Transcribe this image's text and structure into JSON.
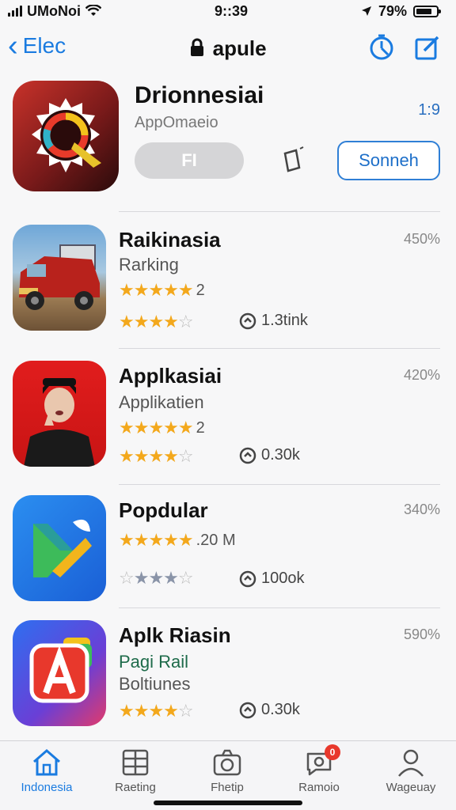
{
  "status": {
    "carrier": "UMoNoi",
    "time": "9::39",
    "battery": "79%",
    "battery_level": 0.79
  },
  "nav": {
    "back_label": "Elec",
    "title": "apule",
    "title_icon": "lock-icon",
    "timer_icon": "timer-icon",
    "compose_icon": "compose-icon"
  },
  "featured": {
    "title": "Drionnesiai",
    "subtitle": "AppOmaeio",
    "get_label": "FI",
    "side_value": "1:9",
    "search_label": "Sonneh"
  },
  "apps": [
    {
      "title": "Raikinasia",
      "percent": "450%",
      "lines": [
        "Rarking"
      ],
      "rating_text": "2",
      "rating_stars": 4,
      "downloads": "1.3tink"
    },
    {
      "title": "Applkasiai",
      "percent": "420%",
      "lines": [
        "Applikatien"
      ],
      "rating_text": "2",
      "rating_stars": 4,
      "downloads": "0.30k"
    },
    {
      "title": "Popdular",
      "percent": "340%",
      "lines": [],
      "rating_text": ".20 M",
      "rating_stars": 4,
      "downloads": "100ok"
    },
    {
      "title": "Aplk Riasin",
      "percent": "590%",
      "lines": [
        "Pagi Rail",
        "Boltiunes"
      ],
      "rating_text": "",
      "rating_stars": 4,
      "downloads": "0.30k"
    }
  ],
  "tabs": [
    {
      "label": "Indonesia",
      "icon": "home-icon"
    },
    {
      "label": "Raeting",
      "icon": "ranking-icon"
    },
    {
      "label": "Fhetip",
      "icon": "camera-icon"
    },
    {
      "label": "Ramoio",
      "icon": "chat-icon",
      "badge": "0"
    },
    {
      "label": "Wageuay",
      "icon": "person-icon"
    }
  ],
  "colors": {
    "accent": "#1a7be0",
    "star": "#f3a81c",
    "badge": "#e8382c"
  }
}
